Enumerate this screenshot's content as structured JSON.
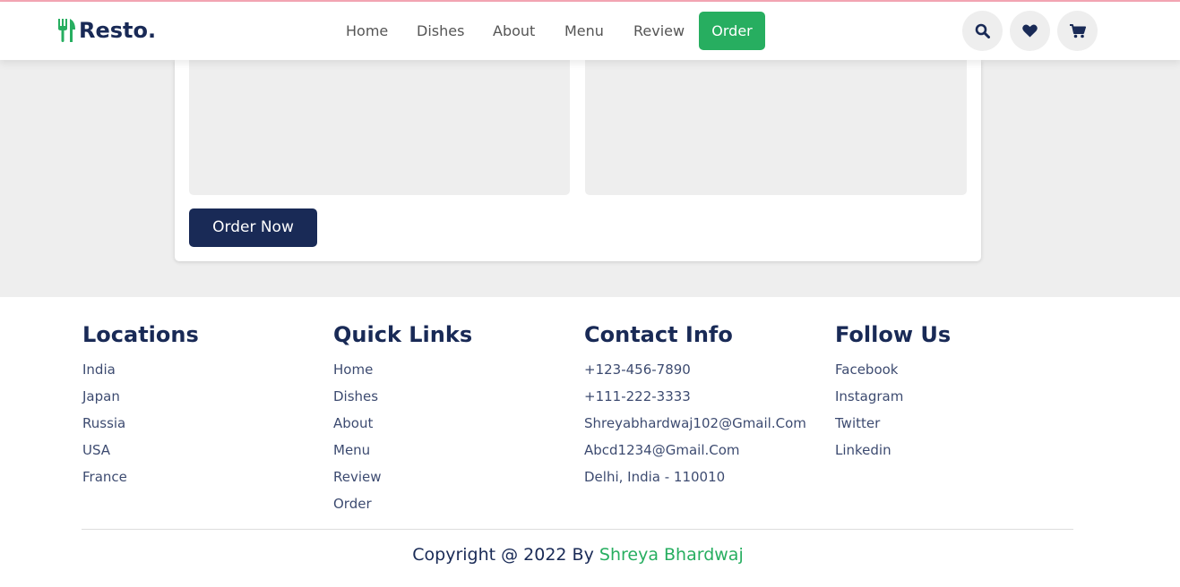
{
  "header": {
    "logo": "Resto.",
    "nav": [
      {
        "label": "Home",
        "active": false
      },
      {
        "label": "Dishes",
        "active": false
      },
      {
        "label": "About",
        "active": false
      },
      {
        "label": "Menu",
        "active": false
      },
      {
        "label": "Review",
        "active": false
      },
      {
        "label": "Order",
        "active": true
      }
    ],
    "icons": [
      "search-icon",
      "heart-icon",
      "cart-icon"
    ]
  },
  "order_form": {
    "submit_label": "Order Now"
  },
  "footer": {
    "columns": [
      {
        "title": "Locations",
        "links": [
          "India",
          "Japan",
          "Russia",
          "USA",
          "France"
        ]
      },
      {
        "title": "Quick Links",
        "links": [
          "Home",
          "Dishes",
          "About",
          "Menu",
          "Review",
          "Order"
        ]
      },
      {
        "title": "Contact Info",
        "links": [
          "+123-456-7890",
          "+111-222-3333",
          "Shreyabhardwaj102@Gmail.Com",
          "Abcd1234@Gmail.Com",
          "Delhi, India - 110010"
        ]
      },
      {
        "title": "Follow Us",
        "links": [
          "Facebook",
          "Instagram",
          "Twitter",
          "Linkedin"
        ]
      }
    ],
    "credit_prefix": "Copyright @ 2022 By",
    "credit_author": "Shreya Bhardwaj"
  },
  "colors": {
    "accent": "#27ae60",
    "primary": "#192a56",
    "background_grey": "#eeeeee"
  }
}
